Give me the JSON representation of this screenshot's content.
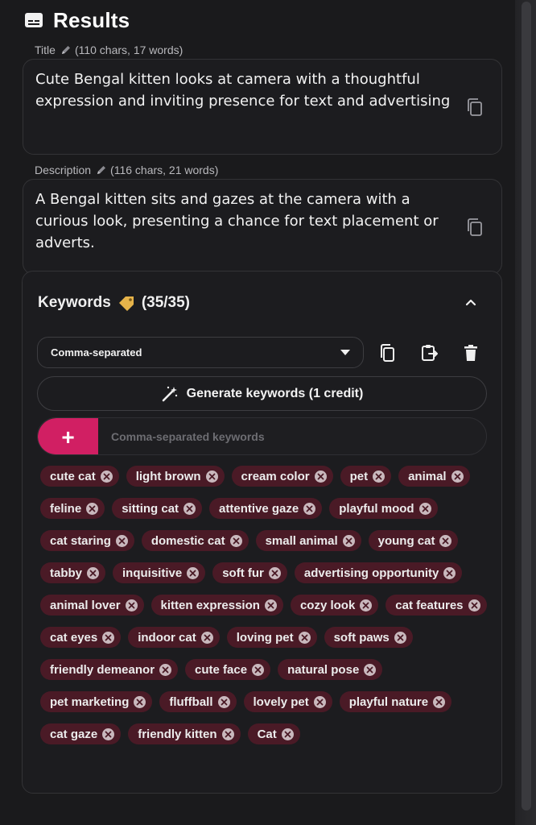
{
  "header": {
    "title": "Results",
    "icon": "subtitles-icon"
  },
  "title_field": {
    "label": "Title",
    "meta": "(110 chars, 17 words)",
    "value": "Cute Bengal kitten looks at camera with a thoughtful expression and inviting presence for text and advertising"
  },
  "description_field": {
    "label": "Description",
    "meta": "(116 chars, 21 words)",
    "value": "A Bengal kitten sits and gazes at the camera with a curious look, presenting a chance for text placement or adverts."
  },
  "keywords": {
    "title": "Keywords",
    "count": "(35/35)",
    "format_select": "Comma-separated",
    "generate_label": "Generate keywords (1 credit)",
    "input_placeholder": "Comma-separated keywords",
    "add_label": "+",
    "accent_color": "#d11f63",
    "chip_color": "#4a1a26",
    "items": [
      "cute cat",
      "light brown",
      "cream color",
      "pet",
      "animal",
      "feline",
      "sitting cat",
      "attentive gaze",
      "playful mood",
      "cat staring",
      "domestic cat",
      "small animal",
      "young cat",
      "tabby",
      "inquisitive",
      "soft fur",
      "advertising opportunity",
      "animal lover",
      "kitten expression",
      "cozy look",
      "cat features",
      "cat eyes",
      "indoor cat",
      "loving pet",
      "soft paws",
      "friendly demeanor",
      "cute face",
      "natural pose",
      "pet marketing",
      "fluffball",
      "lovely pet",
      "playful nature",
      "cat gaze",
      "friendly kitten",
      "Cat"
    ]
  }
}
